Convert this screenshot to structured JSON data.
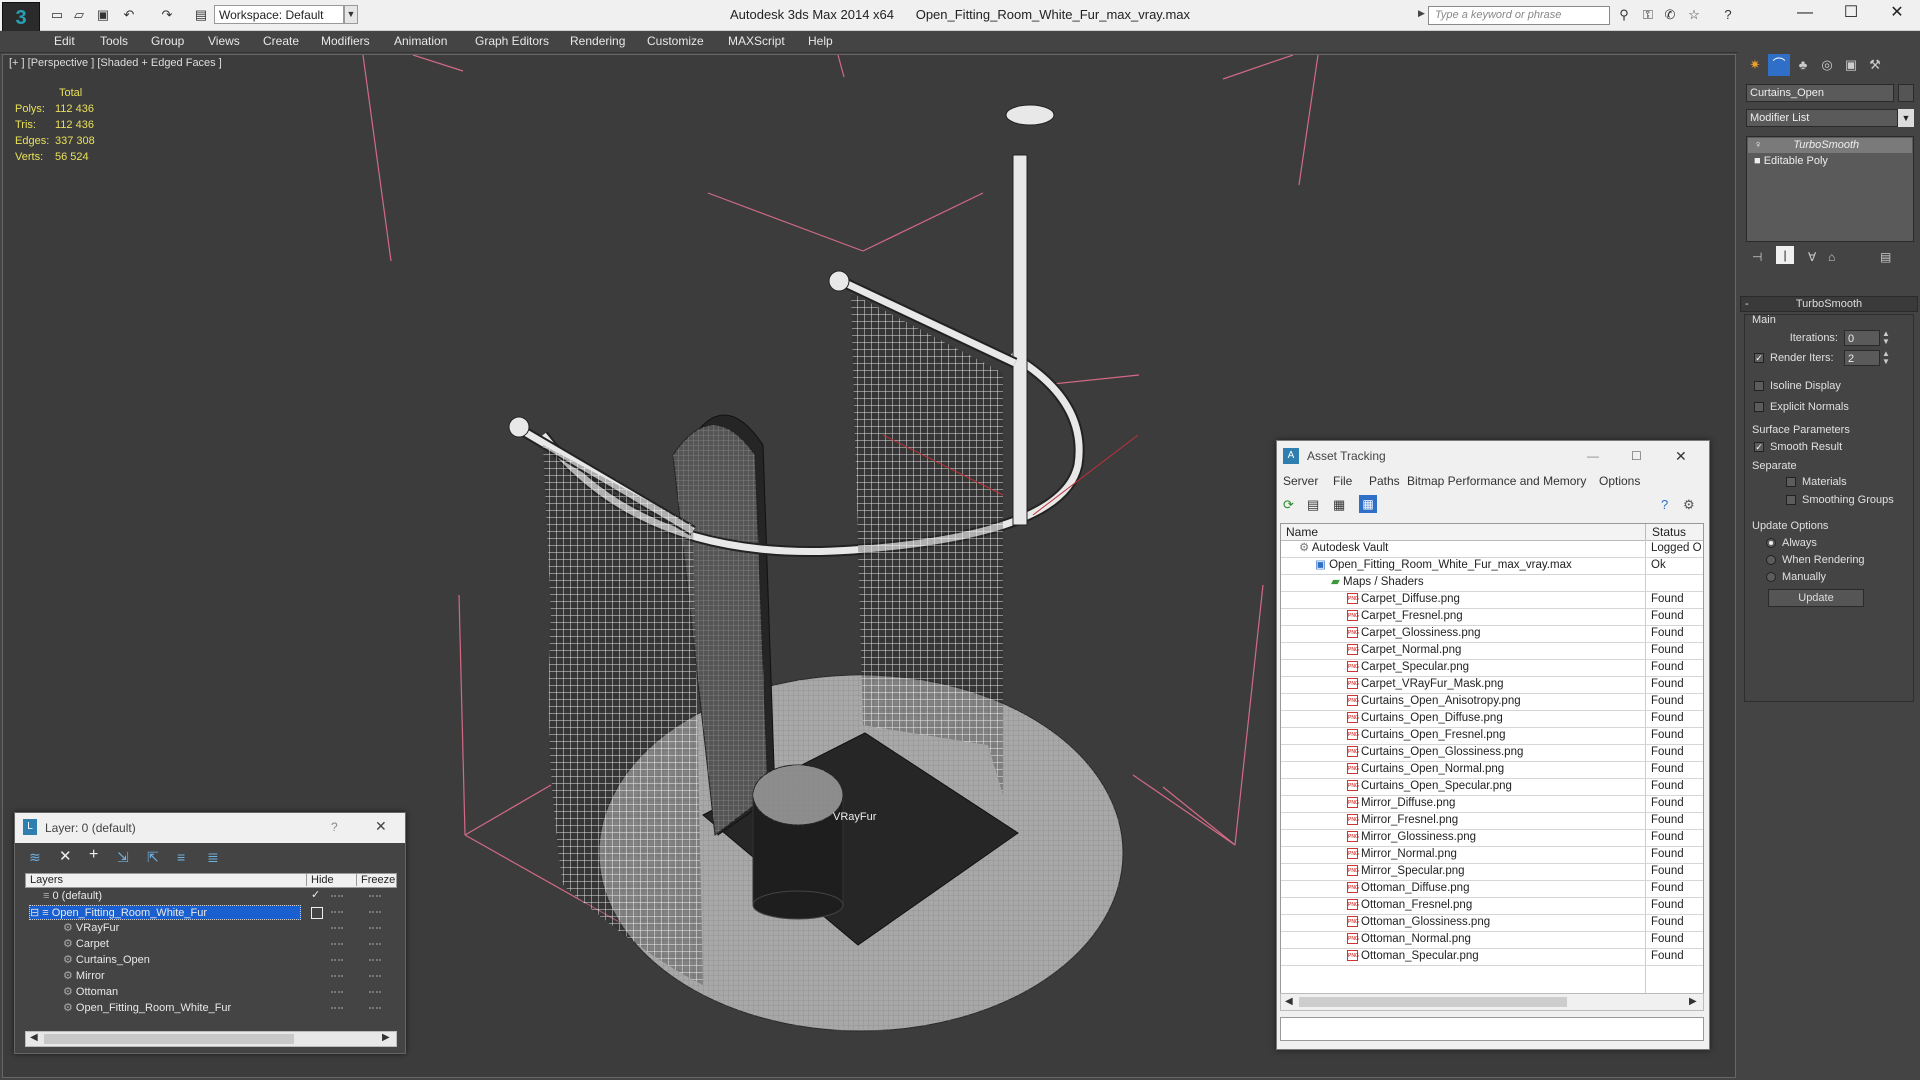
{
  "window": {
    "app_title": "Autodesk 3ds Max  2014 x64",
    "file_title": "Open_Fitting_Room_White_Fur_max_vray.max",
    "workspace": "Workspace: Default",
    "search_placeholder": "Type a keyword or phrase"
  },
  "menubar": [
    "Edit",
    "Tools",
    "Group",
    "Views",
    "Create",
    "Modifiers",
    "Animation",
    "Graph Editors",
    "Rendering",
    "Customize",
    "MAXScript",
    "Help"
  ],
  "viewport": {
    "label": "[+ ] [Perspective ] [Shaded + Edged Faces ]",
    "stats_header": "Total",
    "stats": [
      {
        "label": "Polys:",
        "value": "112 436"
      },
      {
        "label": "Tris:",
        "value": "112 436"
      },
      {
        "label": "Edges:",
        "value": "337 308"
      },
      {
        "label": "Verts:",
        "value": "56 524"
      }
    ],
    "object_label": "VRayFur"
  },
  "command_panel": {
    "object_name": "Curtains_Open",
    "modifier_list": "Modifier List",
    "stack": [
      "TurboSmooth",
      "Editable Poly"
    ],
    "rollout_title": "TurboSmooth",
    "main_label": "Main",
    "iterations_label": "Iterations:",
    "iterations_value": "0",
    "render_iters_label": "Render Iters:",
    "render_iters_value": "2",
    "isoline_label": "Isoline Display",
    "explicit_normals_label": "Explicit Normals",
    "surface_params_label": "Surface Parameters",
    "smooth_result_label": "Smooth Result",
    "separate_label": "Separate",
    "materials_label": "Materials",
    "smoothing_groups_label": "Smoothing Groups",
    "update_options_label": "Update Options",
    "always_label": "Always",
    "when_rendering_label": "When Rendering",
    "manually_label": "Manually",
    "update_button": "Update"
  },
  "asset_tracking": {
    "title": "Asset Tracking",
    "menu": [
      "Server",
      "File",
      "Paths",
      "Bitmap Performance and Memory",
      "Options"
    ],
    "col_name": "Name",
    "col_status": "Status",
    "vault": {
      "name": "Autodesk Vault",
      "status": "Logged O"
    },
    "file": {
      "name": "Open_Fitting_Room_White_Fur_max_vray.max",
      "status": "Ok"
    },
    "maps_group": "Maps / Shaders",
    "maps": [
      {
        "name": "Carpet_Diffuse.png",
        "status": "Found"
      },
      {
        "name": "Carpet_Fresnel.png",
        "status": "Found"
      },
      {
        "name": "Carpet_Glossiness.png",
        "status": "Found"
      },
      {
        "name": "Carpet_Normal.png",
        "status": "Found"
      },
      {
        "name": "Carpet_Specular.png",
        "status": "Found"
      },
      {
        "name": "Carpet_VRayFur_Mask.png",
        "status": "Found"
      },
      {
        "name": "Curtains_Open_Anisotropy.png",
        "status": "Found"
      },
      {
        "name": "Curtains_Open_Diffuse.png",
        "status": "Found"
      },
      {
        "name": "Curtains_Open_Fresnel.png",
        "status": "Found"
      },
      {
        "name": "Curtains_Open_Glossiness.png",
        "status": "Found"
      },
      {
        "name": "Curtains_Open_Normal.png",
        "status": "Found"
      },
      {
        "name": "Curtains_Open_Specular.png",
        "status": "Found"
      },
      {
        "name": "Mirror_Diffuse.png",
        "status": "Found"
      },
      {
        "name": "Mirror_Fresnel.png",
        "status": "Found"
      },
      {
        "name": "Mirror_Glossiness.png",
        "status": "Found"
      },
      {
        "name": "Mirror_Normal.png",
        "status": "Found"
      },
      {
        "name": "Mirror_Specular.png",
        "status": "Found"
      },
      {
        "name": "Ottoman_Diffuse.png",
        "status": "Found"
      },
      {
        "name": "Ottoman_Fresnel.png",
        "status": "Found"
      },
      {
        "name": "Ottoman_Glossiness.png",
        "status": "Found"
      },
      {
        "name": "Ottoman_Normal.png",
        "status": "Found"
      },
      {
        "name": "Ottoman_Specular.png",
        "status": "Found"
      }
    ]
  },
  "layer_manager": {
    "title": "Layer: 0 (default)",
    "help": "?",
    "col_layers": "Layers",
    "col_hide": "Hide",
    "col_freeze": "Freeze",
    "layers": [
      {
        "name": "0 (default)"
      },
      {
        "name": "Open_Fitting_Room_White_Fur"
      }
    ],
    "objects": [
      "VRayFur",
      "Carpet",
      "Curtains_Open",
      "Mirror",
      "Ottoman",
      "Open_Fitting_Room_White_Fur"
    ]
  },
  "colors": {
    "selection": "#1a5fcf",
    "viewport_bg": "#3c3c3c",
    "stats_text": "#e8e05a"
  }
}
